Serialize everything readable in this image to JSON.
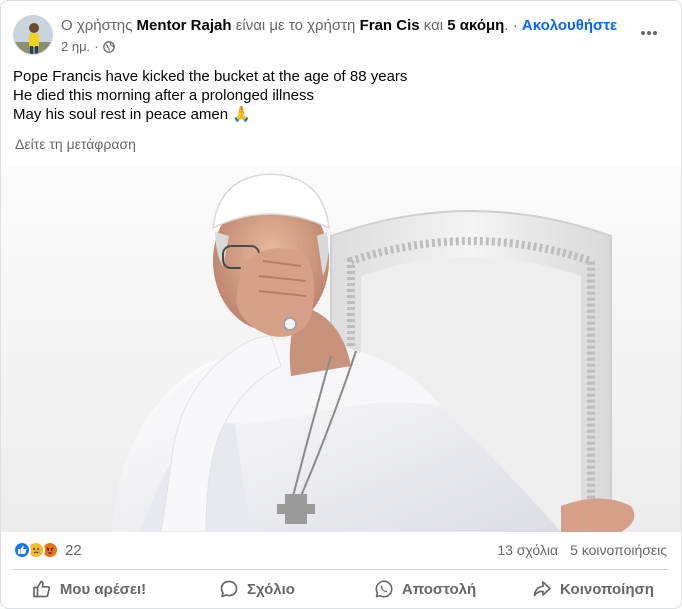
{
  "header": {
    "prefix": "Ο χρήστης",
    "author": "Mentor Rajah",
    "with_text": "είναι με το χρήστη",
    "tagged": "Fran Cis",
    "and_text": "και",
    "others": "5 ακόμη",
    "dot": ". ·",
    "follow_label": "Ακολουθήστε",
    "time": "2 ημ.",
    "separator": "·"
  },
  "post": {
    "lines": [
      "Pope Francis have kicked the bucket at the age of 88 years",
      "He died this morning after a prolonged illness",
      "May his soul rest in peace amen 🙏"
    ],
    "translate_label": "Δείτε τη μετάφραση"
  },
  "engagement": {
    "reaction_count": "22",
    "comments": "13 σχόλια",
    "shares": "5 κοινοποιήσεις"
  },
  "actions": {
    "like": "Μου αρέσει!",
    "comment": "Σχόλιο",
    "send": "Αποστολή",
    "share": "Κοινοποίηση"
  },
  "colors": {
    "link_blue": "#0866ff",
    "muted_text": "#65676b",
    "like_blue": "#1877f2",
    "sad_yellow": "#f7b928",
    "angry_red": "#e9710f"
  }
}
